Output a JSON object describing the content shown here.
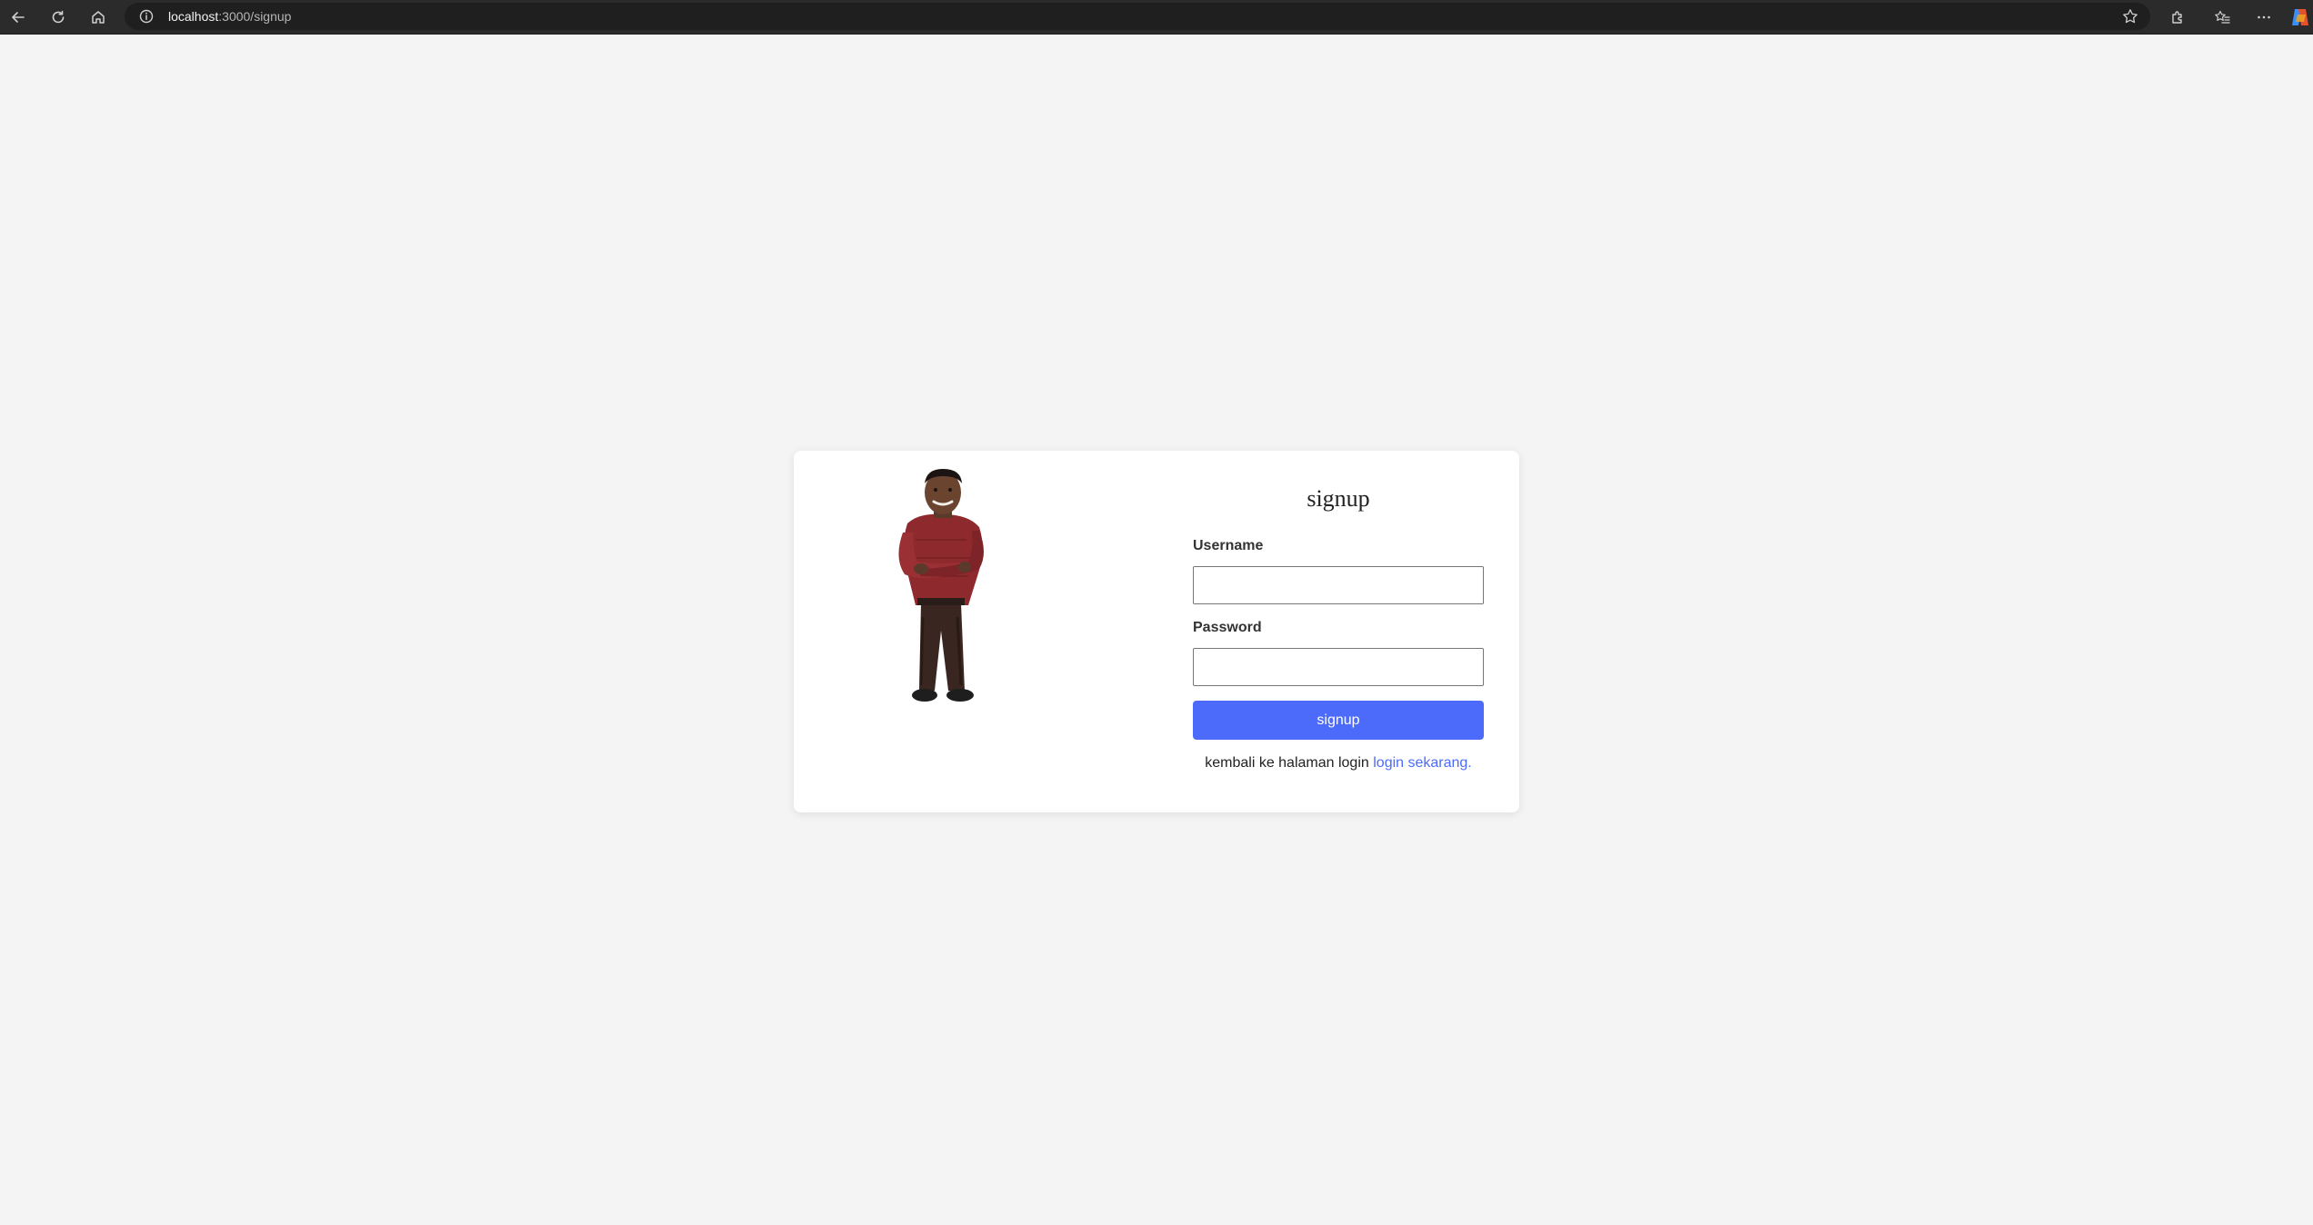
{
  "browser": {
    "url_host": "localhost",
    "url_path": ":3000/signup"
  },
  "colors": {
    "page_background": "#f4f4f4",
    "accent": "#4c6bfa",
    "chrome": "#2b2b2b"
  },
  "illustration": {
    "description_icon": "character-illustration"
  },
  "form": {
    "title": "signup",
    "username_label": "Username",
    "username_value": "",
    "password_label": "Password",
    "password_value": "",
    "submit_label": "signup",
    "footer_text": "kembali ke halaman login ",
    "footer_link": "login sekarang."
  }
}
